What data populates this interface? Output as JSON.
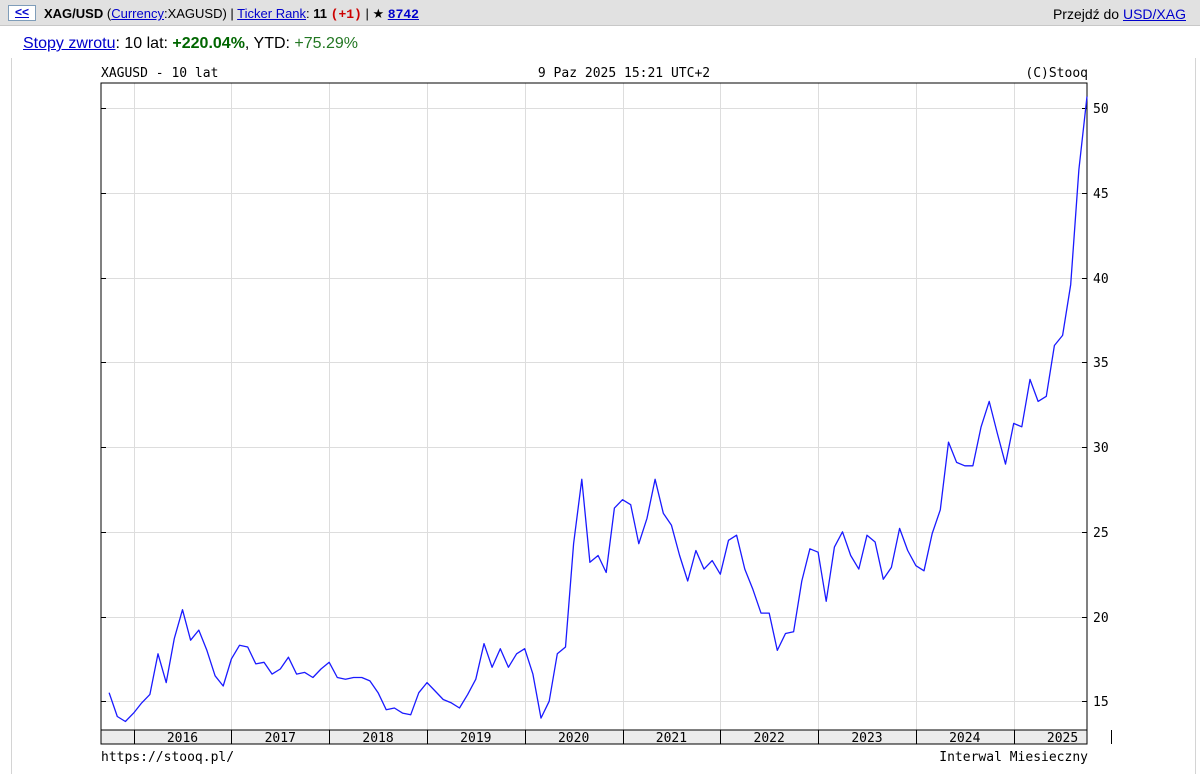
{
  "header": {
    "back_label": "<<",
    "symbol": "XAG/USD",
    "paren_open": "(",
    "category_link": "Currency",
    "ticker_suffix": ":XAGUSD)",
    "separator1": " | ",
    "rank_link": "Ticker Rank",
    "rank_colon": ": ",
    "rank_value": "11",
    "rank_change": "(+1)",
    "separator2": " | ",
    "star": "★",
    "stars_count": "8742",
    "goto_label": "Przejdź do ",
    "goto_link": "USD/XAG"
  },
  "returns": {
    "link": "Stopy zwrotu",
    "colon": ": 10 lat: ",
    "ten_year": "+220.04%",
    "ytd_label": ", YTD: ",
    "ytd": "+75.29%"
  },
  "colors": {
    "line": "#1a1aff",
    "grid": "#dddddd",
    "positive": "#006600"
  },
  "chart_data": {
    "type": "line",
    "title": "XAGUSD - 10 lat",
    "timestamp": "9 Paz 2025 15:21 UTC+2",
    "credit": "(C)Stooq",
    "footer_left": "https://stooq.pl/",
    "footer_right": "Interwal Miesieczny",
    "interval": "monthly",
    "x_start": "2015-10",
    "x_range": [
      "2015-09",
      "2025-10"
    ],
    "ylim": [
      13.3,
      51.5
    ],
    "y_ticks": [
      15,
      20,
      25,
      30,
      35,
      40,
      45,
      50
    ],
    "x_tick_labels": [
      "2016",
      "2017",
      "2018",
      "2019",
      "2020",
      "2021",
      "2022",
      "2023",
      "2024",
      "2025"
    ],
    "y_axis_side": "right",
    "grid": true,
    "series": [
      {
        "values": [
          15.5,
          14.1,
          13.8,
          14.3,
          14.9,
          15.4,
          17.8,
          16.1,
          18.7,
          20.4,
          18.6,
          19.2,
          18.0,
          16.5,
          15.9,
          17.5,
          18.3,
          18.2,
          17.2,
          17.3,
          16.6,
          16.9,
          17.6,
          16.6,
          16.7,
          16.4,
          16.9,
          17.3,
          16.4,
          16.3,
          16.4,
          16.4,
          16.2,
          15.5,
          14.5,
          14.6,
          14.3,
          14.2,
          15.5,
          16.1,
          15.6,
          15.1,
          14.9,
          14.6,
          15.4,
          16.3,
          18.4,
          17.0,
          18.1,
          17.0,
          17.8,
          18.1,
          16.6,
          14.0,
          15.0,
          17.8,
          18.2,
          24.3,
          28.1,
          23.2,
          23.6,
          22.6,
          26.4,
          26.9,
          26.6,
          24.3,
          25.8,
          28.1,
          26.1,
          25.4,
          23.6,
          22.1,
          23.9,
          22.8,
          23.3,
          22.5,
          24.5,
          24.8,
          22.8,
          21.6,
          20.2,
          20.2,
          18.0,
          19.0,
          19.1,
          22.1,
          24.0,
          23.8,
          20.9,
          24.1,
          25.0,
          23.6,
          22.8,
          24.8,
          24.4,
          22.2,
          22.9,
          25.2,
          23.9,
          23.0,
          22.7,
          24.9,
          26.3,
          30.3,
          29.1,
          28.9,
          28.9,
          31.2,
          32.7,
          30.8,
          29.0,
          31.4,
          31.2,
          34.0,
          32.7,
          33.0,
          36.0,
          36.6,
          39.6,
          46.4,
          50.7
        ]
      }
    ]
  }
}
